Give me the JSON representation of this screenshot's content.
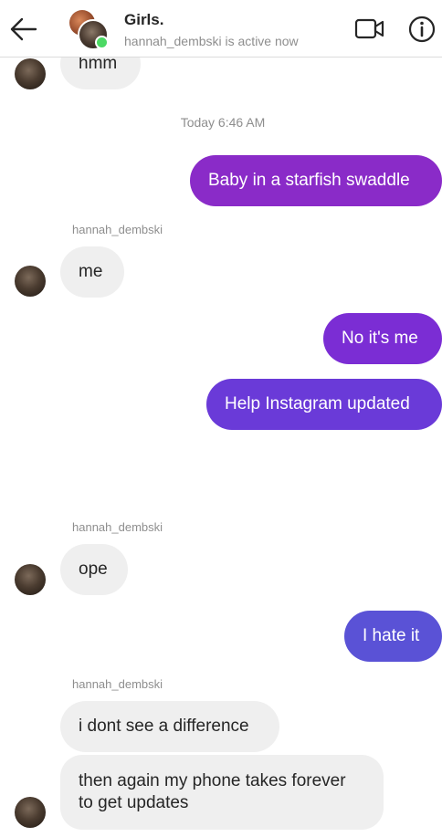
{
  "header": {
    "title": "Girls.",
    "subtitle": "hannah_dembski is active now",
    "back_icon": "arrow-left-icon",
    "video_icon": "video-camera-icon",
    "info_icon": "info-icon"
  },
  "colors": {
    "incoming_bubble": "#efefef",
    "outgoing_1": "#8a2bc8",
    "outgoing_2": "#7b2dd4",
    "outgoing_3": "#6a3ad8",
    "outgoing_4": "#5a52d6",
    "online": "#4cd964"
  },
  "timestamp": "Today 6:46 AM",
  "messages": [
    {
      "from": "them",
      "text": "hmm"
    },
    {
      "from": "me",
      "text": "Baby in a starfish swaddle"
    },
    {
      "from": "them",
      "sender": "hannah_dembski",
      "text": "me"
    },
    {
      "from": "me",
      "text": "No it's me"
    },
    {
      "from": "me",
      "text": "Help Instagram updated"
    },
    {
      "from": "them",
      "sender": "hannah_dembski",
      "text": "ope"
    },
    {
      "from": "me",
      "text": "I hate it"
    },
    {
      "from": "them",
      "sender": "hannah_dembski",
      "text": "i dont see a difference"
    },
    {
      "from": "them",
      "text": "then again my phone takes forever to get updates"
    }
  ]
}
